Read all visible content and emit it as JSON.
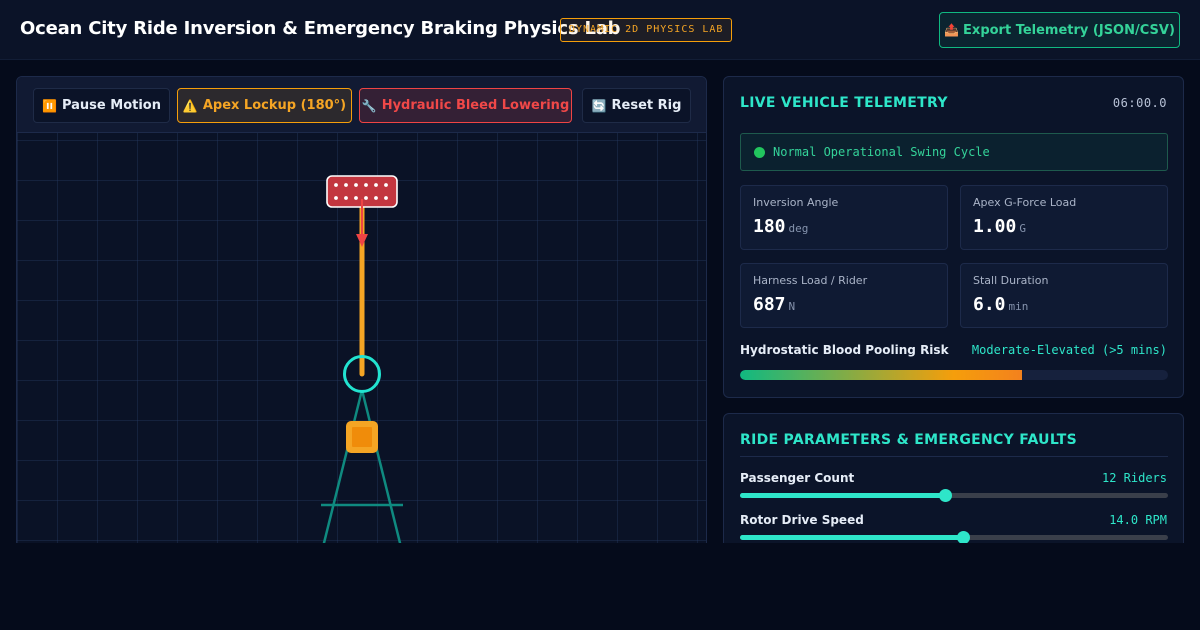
{
  "header": {
    "title": "Ocean City Ride Inversion & Emergency Braking Physics Lab",
    "badge": "DYNAMIC 2D PHYSICS LAB",
    "export_label": "Export Telemetry (JSON/CSV)",
    "export_icon": "📤"
  },
  "toolbar": {
    "pause": {
      "icon": "⏸️",
      "label": "Pause Motion"
    },
    "apex": {
      "icon": "⚠️",
      "label": "Apex Lockup (180°)"
    },
    "bleed": {
      "icon": "🔧",
      "label": "Hydraulic Bleed Lowering"
    },
    "reset": {
      "icon": "🔄",
      "label": "Reset Rig"
    }
  },
  "telemetry": {
    "heading": "LIVE VEHICLE TELEMETRY",
    "clock": "06:00.0",
    "status_text": "Normal Operational Swing Cycle",
    "metrics": [
      {
        "label": "Inversion Angle",
        "value": "180",
        "unit": "deg"
      },
      {
        "label": "Apex G-Force Load",
        "value": "1.00",
        "unit": "G"
      },
      {
        "label": "Harness Load / Rider",
        "value": "687",
        "unit": "N"
      },
      {
        "label": "Stall Duration",
        "value": "6.0",
        "unit": "min"
      }
    ],
    "risk": {
      "label": "Hydrostatic Blood Pooling Risk",
      "value": "Moderate-Elevated (>5 mins)",
      "level": 0.66
    }
  },
  "params": {
    "heading": "RIDE PARAMETERS & EMERGENCY FAULTS",
    "items": [
      {
        "label": "Passenger Count",
        "value": "12 Riders",
        "fraction": 0.48
      },
      {
        "label": "Rotor Drive Speed",
        "value": "14.0 RPM",
        "fraction": 0.52
      }
    ]
  },
  "colors": {
    "accent": "#2ee6c9",
    "warning": "#f5a524",
    "danger": "#ef4444",
    "ok": "#34d399"
  }
}
